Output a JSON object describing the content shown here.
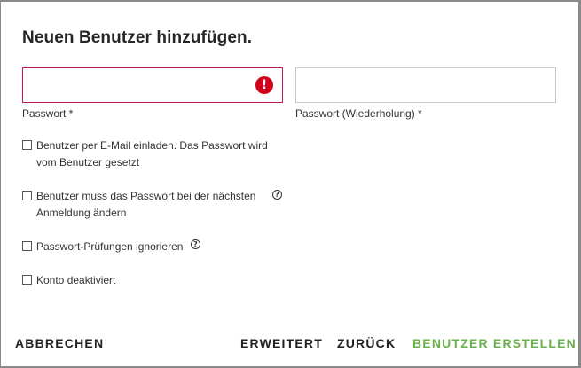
{
  "dialog": {
    "title": "Neuen Benutzer hinzufügen."
  },
  "fields": {
    "password_label": "Passwort *",
    "password_value": "",
    "password_repeat_label": "Passwort (Wiederholung) *",
    "password_repeat_value": "",
    "error_icon_glyph": "!"
  },
  "options": [
    {
      "label": "Benutzer per E-Mail einladen. Das Passwort wird vom Benutzer gesetzt",
      "checked": false
    },
    {
      "label": "Benutzer muss das Passwort bei der nächsten Anmeldung ändern",
      "checked": false,
      "help_glyph": "?"
    },
    {
      "label": "Passwort-Prüfungen ignorieren",
      "checked": false,
      "help_glyph": "?"
    },
    {
      "label": "Konto deaktiviert",
      "checked": false
    }
  ],
  "buttons": {
    "cancel": "ABBRECHEN",
    "advanced": "ERWEITERT",
    "back": "ZURÜCK",
    "create": "BENUTZER ERSTELLEN"
  },
  "colors": {
    "primary_action": "#6ab04c",
    "error": "#d0021b",
    "error_border": "#c2185b"
  }
}
